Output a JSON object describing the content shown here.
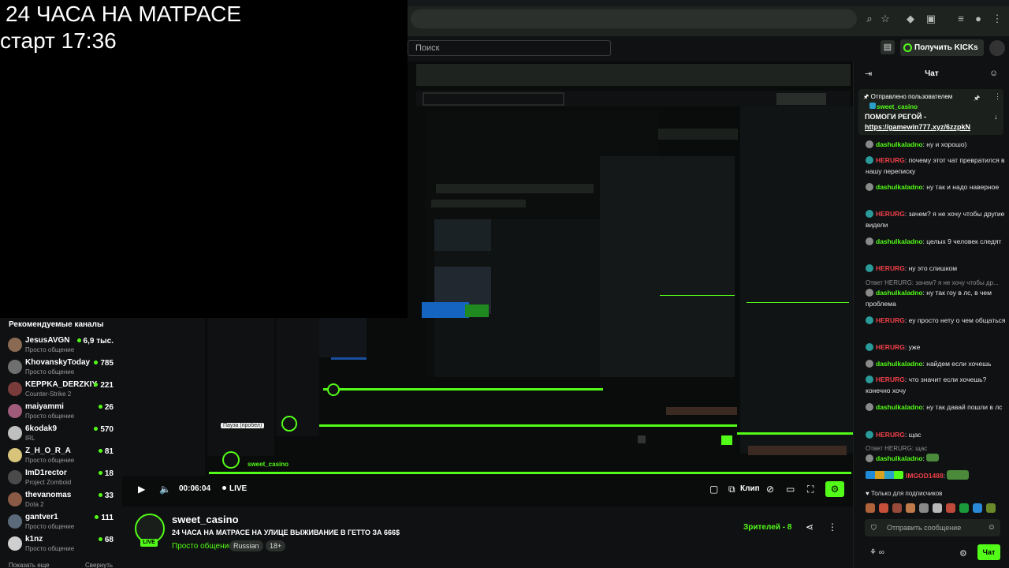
{
  "overlay": {
    "line1": "24 ЧАСА НА МАТРАСЕ",
    "line2": "старт 17:36"
  },
  "colors": {
    "accent": "#53fc18",
    "bg": "#0b0e0f",
    "panel": "#0f1112"
  },
  "header": {
    "search_placeholder": "Поиск",
    "kicks_button": "Получить KICKs"
  },
  "sidebar": {
    "title": "Рекомендуемые каналы",
    "channels": [
      {
        "name": "JesusAVGN",
        "category": "Просто общение",
        "viewers": "6,9 тыс.",
        "color": "#8a6a52"
      },
      {
        "name": "KhovanskyToday",
        "category": "Просто общение",
        "viewers": "785",
        "color": "#6f6f6f"
      },
      {
        "name": "KEPPKA_DERZKIY",
        "category": "Counter-Strike 2",
        "viewers": "221",
        "color": "#7a3b3b"
      },
      {
        "name": "maiyammi",
        "category": "Просто общение",
        "viewers": "26",
        "color": "#a05a7a"
      },
      {
        "name": "6kodak9",
        "category": "IRL",
        "viewers": "570",
        "color": "#bfbfbf"
      },
      {
        "name": "Z_H_O_R_A",
        "category": "Просто общение",
        "viewers": "81",
        "color": "#d8c37a"
      },
      {
        "name": "ImD1rector",
        "category": "Project Zomboid",
        "viewers": "18",
        "color": "#4a4a4a"
      },
      {
        "name": "thevanomas",
        "category": "Dota 2",
        "viewers": "33",
        "color": "#8a5a45"
      },
      {
        "name": "gantver1",
        "category": "Просто общение",
        "viewers": "111",
        "color": "#5a6a7a"
      },
      {
        "name": "k1nz",
        "category": "Просто общение",
        "viewers": "68",
        "color": "#cfcfcf"
      }
    ],
    "footer_more": "Показать еще",
    "footer_collapse": "Свернуть"
  },
  "player": {
    "time": "00:06:04",
    "live": "LIVE",
    "clip": "Клип",
    "tooltip": "Пауза (пробел)"
  },
  "stream": {
    "live_badge": "LIVE",
    "channel": "sweet_casino",
    "title": "24 ЧАСА НА МАТРАСЕ НА УЛИЦЕ ВЫЖИВАНИЕ В ГЕТТО ЗА 666$",
    "category": "Просто общение",
    "tags": [
      "Russian",
      "18+"
    ],
    "viewers_label": "Зрителей -",
    "viewers_count": "8"
  },
  "chat": {
    "title": "Чат",
    "pinned_label": "Отправлено пользователем",
    "pinned_user": "sweet_casino",
    "pinned_text": "ПОМОГИ РЕГОЙ -",
    "pinned_link": "https://gamewin777.xyz/6zzpkN",
    "messages": [
      {
        "user": "dashulkaladno",
        "text": "ну и хорошо)",
        "ucolor": "#53fc18",
        "bcolor": "#8a8a8a"
      },
      {
        "user": "HERURG",
        "text": "почему этот чат превратился в нашу переписку",
        "ucolor": "#f0404a",
        "bcolor": "#2a9a9a"
      },
      {
        "user": "dashulkaladno",
        "text": "ну так и надо наверное",
        "ucolor": "#53fc18",
        "bcolor": "#8a8a8a"
      },
      {
        "user": "HERURG",
        "text": "зачем? я не хочу чтобы другие видели",
        "ucolor": "#f0404a",
        "bcolor": "#2a9a9a"
      },
      {
        "user": "dashulkaladno",
        "text": "целых 9 человек следят",
        "ucolor": "#53fc18",
        "bcolor": "#8a8a8a"
      },
      {
        "user": "HERURG",
        "text": "ну это слишком",
        "ucolor": "#f0404a",
        "bcolor": "#2a9a9a"
      },
      {
        "user": "dashulkaladno",
        "text": "ну так гоу в лс, в чем проблема",
        "ucolor": "#53fc18",
        "bcolor": "#8a8a8a",
        "reply": "Ответ HERURG: зачем? я не хочу чтобы др..."
      },
      {
        "user": "HERURG",
        "text": "еу просто нету о чем общаться",
        "ucolor": "#f0404a",
        "bcolor": "#2a9a9a"
      },
      {
        "user": "HERURG",
        "text": "уже",
        "ucolor": "#f0404a",
        "bcolor": "#2a9a9a"
      },
      {
        "user": "dashulkaladno",
        "text": "найдем если хочешь",
        "ucolor": "#53fc18",
        "bcolor": "#8a8a8a"
      },
      {
        "user": "HERURG",
        "text": "что значит если хочешь? конечно хочу",
        "ucolor": "#f0404a",
        "bcolor": "#2a9a9a"
      },
      {
        "user": "dashulkaladno",
        "text": "ну так давай пошли в лс",
        "ucolor": "#53fc18",
        "bcolor": "#8a8a8a"
      },
      {
        "user": "HERURG",
        "text": "щас",
        "ucolor": "#f0404a",
        "bcolor": "#2a9a9a"
      },
      {
        "user": "dashulkaladno",
        "text": "",
        "ucolor": "#53fc18",
        "bcolor": "#8a8a8a",
        "reply": "Ответ HERURG: щас"
      },
      {
        "user": "IMGOD1488",
        "text": "",
        "ucolor": "#f0404a",
        "bcolor": "#2a9a9a"
      }
    ],
    "subs_only": "Только для подписчиков",
    "input_placeholder": "Отправить сообщение",
    "send": "Чат"
  }
}
